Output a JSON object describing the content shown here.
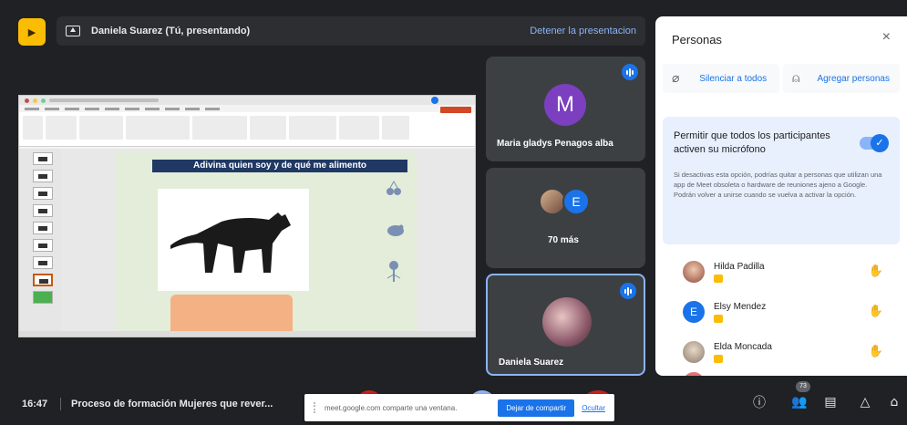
{
  "header": {
    "presenter_label": "Daniela Suarez (Tú, presentando)",
    "stop_presenting": "Detener la presentacion"
  },
  "slide": {
    "title": "Adivina quien soy y de qué me alimento"
  },
  "tiles": [
    {
      "initial": "M",
      "name": "Maria gladys Penagos alba"
    },
    {
      "initial": "E",
      "name": "70 más"
    },
    {
      "name": "Daniela Suarez"
    }
  ],
  "panel": {
    "title": "Personas",
    "close": "×",
    "mute_all": "Silenciar a todos",
    "add_people": "Agregar personas",
    "permission_label": "Permitir que todos los participantes activen su micrófono",
    "permission_note": "Si desactivas esta opción, podrías quitar a personas que utilizan una app de Meet obsoleta o hardware de reuniones ajeno a Google. Podrán volver a unirse cuando se vuelva a activar la opción.",
    "participants": [
      {
        "name": "Hilda Padilla"
      },
      {
        "initial": "E",
        "name": "Elsy Mendez"
      },
      {
        "name": "Elda Moncada"
      }
    ]
  },
  "footer": {
    "time": "16:47",
    "meeting_title": "Proceso de formación Mujeres que rever...",
    "participant_count": "73",
    "share_notice": "meet.google.com comparte una ventana.",
    "stop_sharing": "Dejar de compartir",
    "hide": "Ocultar"
  },
  "colors": {
    "accent": "#1a73e8",
    "meet_yellow": "#fbbc04",
    "slide_header": "#1f3864",
    "avatar_m": "#7b3fbf"
  },
  "icons": [
    "meet-logo-icon",
    "present-icon",
    "sound-wave-icon",
    "mic-off-icon",
    "person-add-icon",
    "close-icon",
    "hand-icon",
    "info-icon",
    "people-icon",
    "chat-icon",
    "activities-icon",
    "lock-icon"
  ]
}
